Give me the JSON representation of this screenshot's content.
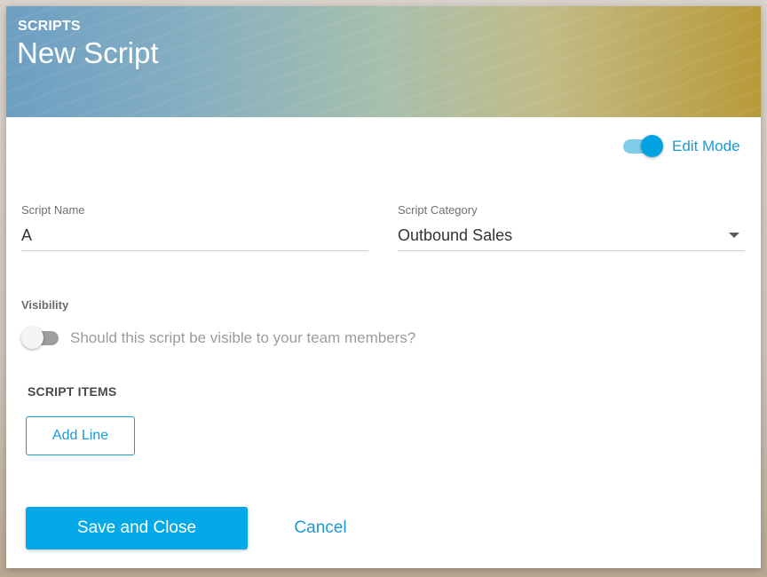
{
  "header": {
    "overline": "SCRIPTS",
    "title": "New Script"
  },
  "edit_mode": {
    "label": "Edit Mode",
    "enabled": true
  },
  "form": {
    "script_name": {
      "label": "Script Name",
      "value": "A"
    },
    "script_category": {
      "label": "Script Category",
      "value": "Outbound Sales"
    },
    "visibility": {
      "label": "Visibility",
      "toggle_text": "Should this script be visible to your team members?",
      "enabled": false
    }
  },
  "script_items": {
    "title": "SCRIPT ITEMS",
    "add_line_label": "Add Line"
  },
  "actions": {
    "save_label": "Save and Close",
    "cancel_label": "Cancel"
  },
  "colors": {
    "accent": "#03a9e6",
    "link": "#1a9ad6",
    "toggle_track_on": "#7fcde9",
    "toggle_thumb_on": "#02a3e0",
    "toggle_track_off": "#9e9e9e"
  },
  "icons": {
    "dropdown": "chevron-down-icon"
  }
}
